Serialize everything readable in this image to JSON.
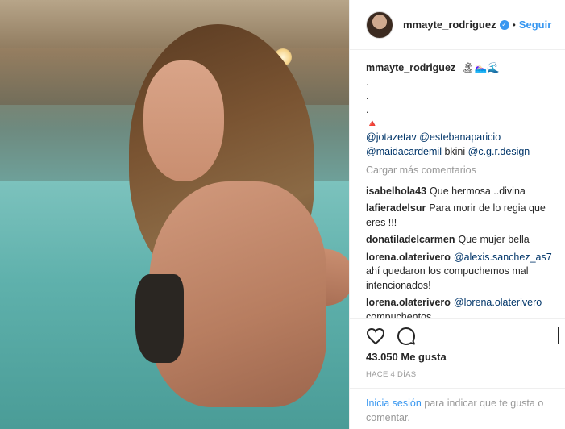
{
  "post": {
    "username": "mmayte_rodriguez",
    "verified_badge": "✓",
    "separator": "•",
    "follow_label": "Seguir",
    "caption": {
      "username": "mmayte_rodriguez",
      "text": " 🏝🏊🏻‍♀️🌊",
      "dots": [
        ".",
        ".",
        "."
      ],
      "symbol": "🔺"
    },
    "mentions_line_1": [
      "@jotazetav",
      "@estebanaparicio"
    ],
    "mentions_line_2_a": "@maidacardemil",
    "mentions_line_2_b": " bkini ",
    "mentions_line_2_c": "@c.g.r.design",
    "load_more": "Cargar más comentarios",
    "comments": [
      {
        "user": "isabelhola43",
        "text": "Que hermosa ..divina"
      },
      {
        "user": "lafieradelsur",
        "text": "Para morir de lo regia que eres !!!"
      },
      {
        "user": "donatiladelcarmen",
        "text": "Que mujer bella"
      },
      {
        "user": "lorena.olaterivero",
        "mention": "@alexis.sanchez_as7",
        "text": " ahí quedaron los compuchemos mal intencionados!"
      },
      {
        "user": "lorena.olaterivero",
        "mention": "@lorena.olaterivero",
        "text": " compuchentos"
      }
    ],
    "likes": "43.050 Me gusta",
    "time": "HACE 4 DÍAS",
    "login_link": "Inicia sesión",
    "login_text": " para indicar que te gusta o comentar."
  },
  "icons": [
    "heart-icon",
    "comment-icon",
    "bookmark-icon"
  ],
  "colors": {
    "accent": "#3897f0",
    "mention": "#003569",
    "muted": "#999999",
    "text": "#262626"
  }
}
